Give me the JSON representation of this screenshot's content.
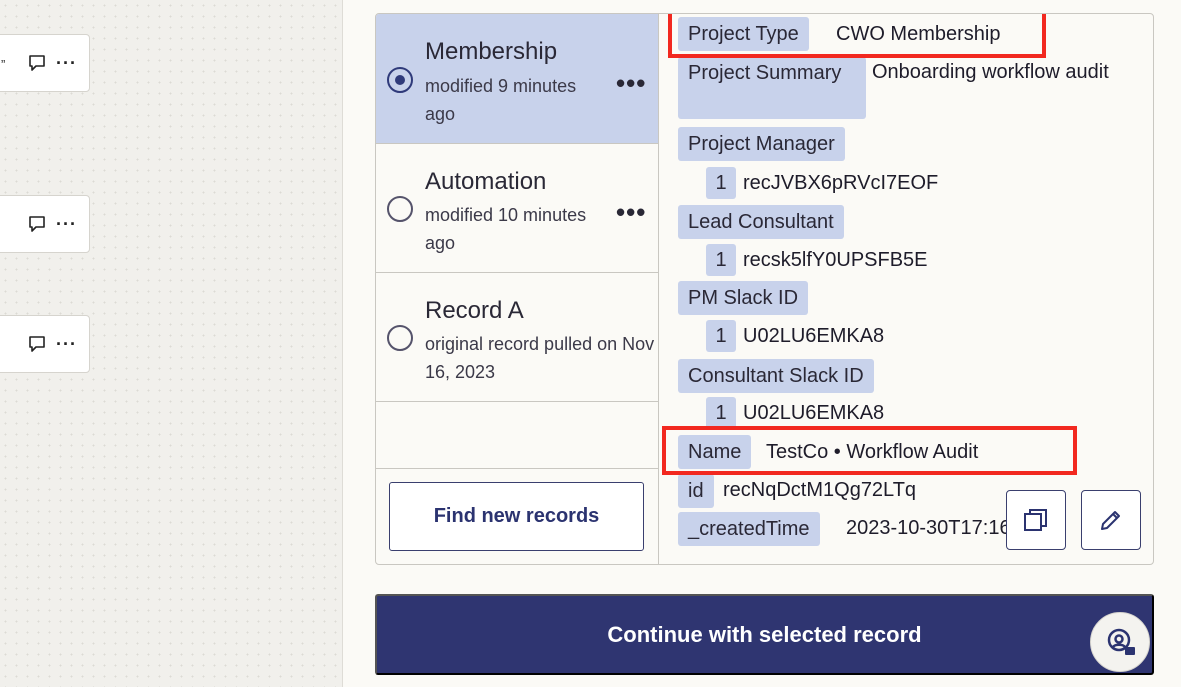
{
  "canvas": {
    "cards": [
      {
        "quote": "”"
      },
      {
        "quote": ""
      },
      {
        "quote": ""
      }
    ]
  },
  "records": [
    {
      "title": "Membership",
      "meta": "modified 9 minutes ago",
      "selected": true
    },
    {
      "title": "Automation",
      "meta": "modified 10 minutes ago",
      "selected": false
    },
    {
      "title": "Record A",
      "meta": "original record pulled on Nov 16, 2023",
      "selected": false
    }
  ],
  "more_label": "•••",
  "find_button": "Find new records",
  "fields": {
    "project_type": {
      "label": "Project Type",
      "value": "CWO Membership"
    },
    "project_summary": {
      "label": "Project Summary",
      "value": "Onboarding workflow audit"
    },
    "project_manager": {
      "label": "Project Manager",
      "index": "1",
      "value": "recJVBX6pRVcI7EOF"
    },
    "lead_consultant": {
      "label": "Lead Consultant",
      "index": "1",
      "value": "recsk5lfY0UPSFB5E"
    },
    "pm_slack_id": {
      "label": "PM Slack ID",
      "index": "1",
      "value": "U02LU6EMKA8"
    },
    "consultant_slack_id": {
      "label": "Consultant Slack ID",
      "index": "1",
      "value": "U02LU6EMKA8"
    },
    "name": {
      "label": "Name",
      "value": "TestCo • Workflow Audit"
    },
    "id": {
      "label": "id",
      "value": "recNqDctM1Qg72LTq"
    },
    "created_time": {
      "label": "_createdTime",
      "value": "2023-10-30T17:16:2"
    }
  },
  "continue_button": "Continue with selected record",
  "colors": {
    "accent": "#2f3571",
    "selection": "#c8d2eb",
    "highlight": "#f2281f"
  }
}
